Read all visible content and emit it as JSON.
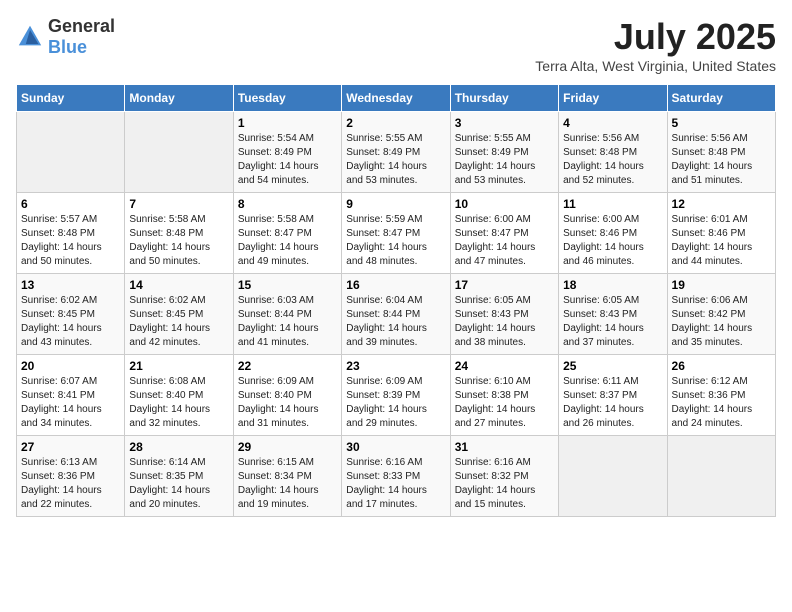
{
  "header": {
    "logo_general": "General",
    "logo_blue": "Blue",
    "month_title": "July 2025",
    "location": "Terra Alta, West Virginia, United States"
  },
  "weekdays": [
    "Sunday",
    "Monday",
    "Tuesday",
    "Wednesday",
    "Thursday",
    "Friday",
    "Saturday"
  ],
  "weeks": [
    [
      {
        "day": "",
        "info": ""
      },
      {
        "day": "",
        "info": ""
      },
      {
        "day": "1",
        "info": "Sunrise: 5:54 AM\nSunset: 8:49 PM\nDaylight: 14 hours and 54 minutes."
      },
      {
        "day": "2",
        "info": "Sunrise: 5:55 AM\nSunset: 8:49 PM\nDaylight: 14 hours and 53 minutes."
      },
      {
        "day": "3",
        "info": "Sunrise: 5:55 AM\nSunset: 8:49 PM\nDaylight: 14 hours and 53 minutes."
      },
      {
        "day": "4",
        "info": "Sunrise: 5:56 AM\nSunset: 8:48 PM\nDaylight: 14 hours and 52 minutes."
      },
      {
        "day": "5",
        "info": "Sunrise: 5:56 AM\nSunset: 8:48 PM\nDaylight: 14 hours and 51 minutes."
      }
    ],
    [
      {
        "day": "6",
        "info": "Sunrise: 5:57 AM\nSunset: 8:48 PM\nDaylight: 14 hours and 50 minutes."
      },
      {
        "day": "7",
        "info": "Sunrise: 5:58 AM\nSunset: 8:48 PM\nDaylight: 14 hours and 50 minutes."
      },
      {
        "day": "8",
        "info": "Sunrise: 5:58 AM\nSunset: 8:47 PM\nDaylight: 14 hours and 49 minutes."
      },
      {
        "day": "9",
        "info": "Sunrise: 5:59 AM\nSunset: 8:47 PM\nDaylight: 14 hours and 48 minutes."
      },
      {
        "day": "10",
        "info": "Sunrise: 6:00 AM\nSunset: 8:47 PM\nDaylight: 14 hours and 47 minutes."
      },
      {
        "day": "11",
        "info": "Sunrise: 6:00 AM\nSunset: 8:46 PM\nDaylight: 14 hours and 46 minutes."
      },
      {
        "day": "12",
        "info": "Sunrise: 6:01 AM\nSunset: 8:46 PM\nDaylight: 14 hours and 44 minutes."
      }
    ],
    [
      {
        "day": "13",
        "info": "Sunrise: 6:02 AM\nSunset: 8:45 PM\nDaylight: 14 hours and 43 minutes."
      },
      {
        "day": "14",
        "info": "Sunrise: 6:02 AM\nSunset: 8:45 PM\nDaylight: 14 hours and 42 minutes."
      },
      {
        "day": "15",
        "info": "Sunrise: 6:03 AM\nSunset: 8:44 PM\nDaylight: 14 hours and 41 minutes."
      },
      {
        "day": "16",
        "info": "Sunrise: 6:04 AM\nSunset: 8:44 PM\nDaylight: 14 hours and 39 minutes."
      },
      {
        "day": "17",
        "info": "Sunrise: 6:05 AM\nSunset: 8:43 PM\nDaylight: 14 hours and 38 minutes."
      },
      {
        "day": "18",
        "info": "Sunrise: 6:05 AM\nSunset: 8:43 PM\nDaylight: 14 hours and 37 minutes."
      },
      {
        "day": "19",
        "info": "Sunrise: 6:06 AM\nSunset: 8:42 PM\nDaylight: 14 hours and 35 minutes."
      }
    ],
    [
      {
        "day": "20",
        "info": "Sunrise: 6:07 AM\nSunset: 8:41 PM\nDaylight: 14 hours and 34 minutes."
      },
      {
        "day": "21",
        "info": "Sunrise: 6:08 AM\nSunset: 8:40 PM\nDaylight: 14 hours and 32 minutes."
      },
      {
        "day": "22",
        "info": "Sunrise: 6:09 AM\nSunset: 8:40 PM\nDaylight: 14 hours and 31 minutes."
      },
      {
        "day": "23",
        "info": "Sunrise: 6:09 AM\nSunset: 8:39 PM\nDaylight: 14 hours and 29 minutes."
      },
      {
        "day": "24",
        "info": "Sunrise: 6:10 AM\nSunset: 8:38 PM\nDaylight: 14 hours and 27 minutes."
      },
      {
        "day": "25",
        "info": "Sunrise: 6:11 AM\nSunset: 8:37 PM\nDaylight: 14 hours and 26 minutes."
      },
      {
        "day": "26",
        "info": "Sunrise: 6:12 AM\nSunset: 8:36 PM\nDaylight: 14 hours and 24 minutes."
      }
    ],
    [
      {
        "day": "27",
        "info": "Sunrise: 6:13 AM\nSunset: 8:36 PM\nDaylight: 14 hours and 22 minutes."
      },
      {
        "day": "28",
        "info": "Sunrise: 6:14 AM\nSunset: 8:35 PM\nDaylight: 14 hours and 20 minutes."
      },
      {
        "day": "29",
        "info": "Sunrise: 6:15 AM\nSunset: 8:34 PM\nDaylight: 14 hours and 19 minutes."
      },
      {
        "day": "30",
        "info": "Sunrise: 6:16 AM\nSunset: 8:33 PM\nDaylight: 14 hours and 17 minutes."
      },
      {
        "day": "31",
        "info": "Sunrise: 6:16 AM\nSunset: 8:32 PM\nDaylight: 14 hours and 15 minutes."
      },
      {
        "day": "",
        "info": ""
      },
      {
        "day": "",
        "info": ""
      }
    ]
  ]
}
